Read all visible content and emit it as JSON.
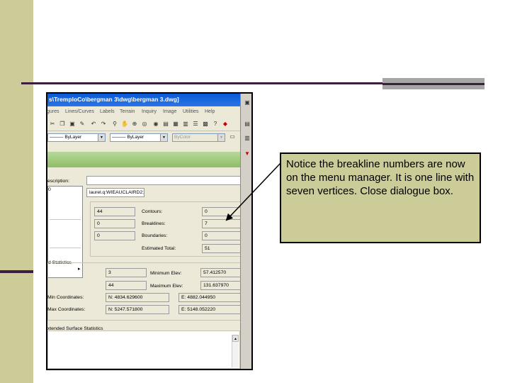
{
  "screenshot": {
    "title": "s\\TremploCo\\bergman 3\\dwg\\bergman 3.dwg]",
    "menu": [
      "gures",
      "Lines/Curves",
      "Labels",
      "Terrain",
      "Inquiry",
      "Image",
      "Utilities",
      "Help"
    ],
    "layer_combo_1": "ByLayer",
    "layer_combo_2": "ByLayer",
    "color_combo": "ByColor",
    "description_label": "escription:",
    "description_value": "",
    "popup_prefix": "0",
    "popup_item": "d Statistics",
    "popup_submenu_arrow": "▸",
    "file_value": "laurel.q:WIEAUCLAIRD2;",
    "points": {
      "val1": "44",
      "val2": "0",
      "val3": "0"
    },
    "stats": {
      "contours_label": "Contours:",
      "contours_value": "0",
      "breaklines_label": "Breaklines:",
      "breaklines_value": "7",
      "boundaries_label": "Boundaries:",
      "boundaries_value": "0",
      "estimated_label": "Estimated Total:",
      "estimated_value": "51"
    },
    "surface": {
      "val_a": "3",
      "val_b": "44",
      "min_elev_label": "Minimum Elev:",
      "min_elev_value": "57.412570",
      "max_elev_label": "Maximum Elev:",
      "max_elev_value": "131.637970",
      "min_coord_label": "Min Coordinates:",
      "min_n": "N: 4834.629600",
      "min_e": "E: 4882.044950",
      "max_coord_label": "Max Coordinates:",
      "max_n": "N: 5247.571800",
      "max_e": "E: 5148.052220"
    },
    "extended_label": "xtended Surface Statistics"
  },
  "callout": {
    "text": "Notice the breakline numbers are now on the menu manager.  It is one line with seven vertices.  Close dialogue box."
  },
  "colors": {
    "left_bar": "#cccc99",
    "rule": "#3d1f3d",
    "callout_bg": "#cccc99",
    "title_bar": "#0a5ad6"
  }
}
